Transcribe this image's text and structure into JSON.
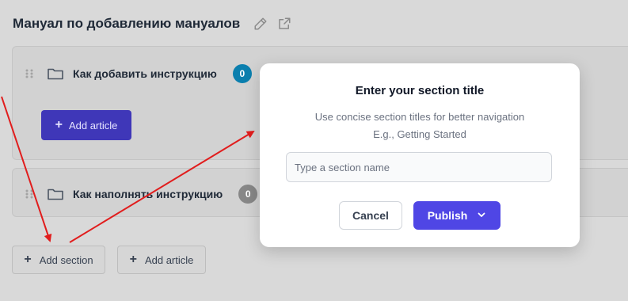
{
  "page": {
    "title": "Мануал по добавлению мануалов",
    "edit_icon": "pencil-icon",
    "open_icon": "external-link-icon"
  },
  "sections": [
    {
      "name": "Как добавить инструкцию",
      "count": "0",
      "badge_color": "#0b7fae",
      "add_article_label": "Add article"
    },
    {
      "name": "Как наполнять инструкцию",
      "count": "0",
      "badge_color": "#878787"
    }
  ],
  "footer": {
    "add_section_label": "Add section",
    "add_article_label": "Add article"
  },
  "modal": {
    "title": "Enter your section title",
    "subtitle": "Use concise section titles for better navigation",
    "example": "E.g., Getting Started",
    "input_placeholder": "Type a section name",
    "input_value": "",
    "cancel_label": "Cancel",
    "publish_label": "Publish"
  },
  "colors": {
    "accent": "#4f46e5",
    "annotation_arrow": "#e11d1d"
  }
}
